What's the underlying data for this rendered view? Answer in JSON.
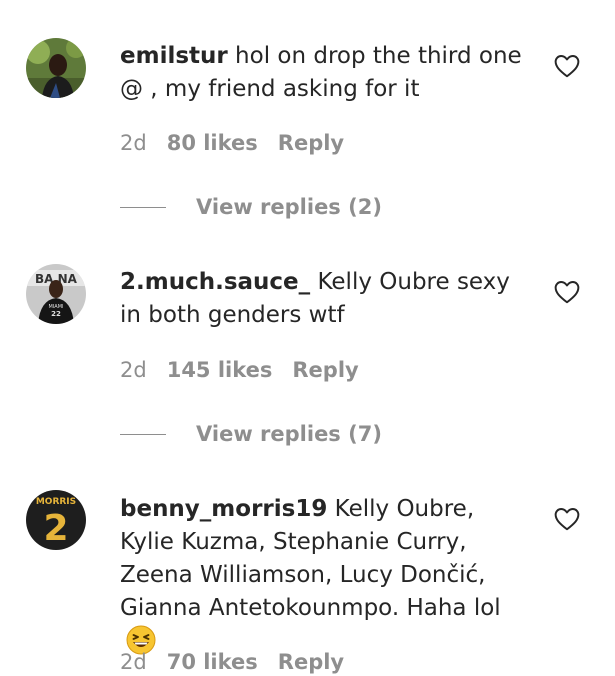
{
  "comments": [
    {
      "username": "emilstur",
      "text": " hol on drop the third one @ , my friend asking for it",
      "time": "2d",
      "likes": "80 likes",
      "reply": "Reply",
      "view_replies": "View replies (2)"
    },
    {
      "username": "2.much.sauce_",
      "text": " Kelly Oubre sexy in both genders wtf",
      "time": "2d",
      "likes": "145 likes",
      "reply": "Reply",
      "view_replies": "View replies (7)"
    },
    {
      "username": "benny_morris19",
      "text": " Kelly Oubre, Kylie Kuzma, Stephanie Curry, Zeena Williamson, Lucy Dončić, Gianna Antetokounmpo. Haha lol",
      "emoji": "grinning-squinting-face",
      "time": "2d",
      "likes": "70 likes",
      "reply": "Reply"
    }
  ],
  "avatar2_text": {
    "banner": "BA NA",
    "jersey": "MIAMI",
    "number": "22"
  },
  "avatar3_text": {
    "name": "MORRIS",
    "number": "2"
  },
  "colors": {
    "text": "#262626",
    "secondary": "#8e8e8e",
    "background": "#ffffff"
  }
}
